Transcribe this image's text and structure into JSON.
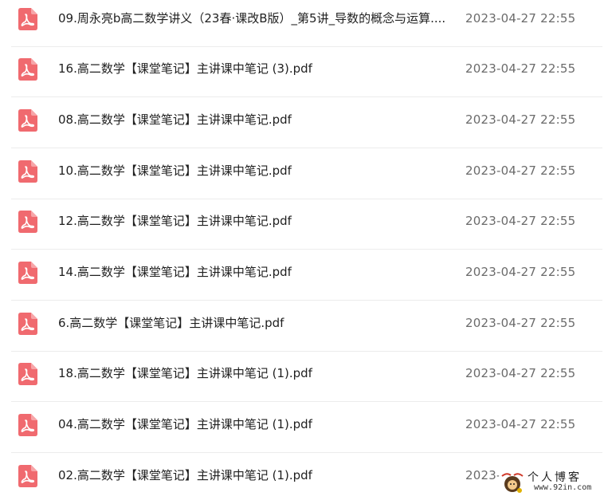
{
  "files": [
    {
      "name": "09.周永亮b高二数学讲义（23春·课改B版）_第5讲_导数的概念与运算....",
      "date": "2023-04-27 22:55",
      "icon": "pdf-icon"
    },
    {
      "name": "16.高二数学【课堂笔记】主讲课中笔记 (3).pdf",
      "date": "2023-04-27 22:55",
      "icon": "pdf-icon"
    },
    {
      "name": "08.高二数学【课堂笔记】主讲课中笔记.pdf",
      "date": "2023-04-27 22:55",
      "icon": "pdf-icon"
    },
    {
      "name": "10.高二数学【课堂笔记】主讲课中笔记.pdf",
      "date": "2023-04-27 22:55",
      "icon": "pdf-icon"
    },
    {
      "name": "12.高二数学【课堂笔记】主讲课中笔记.pdf",
      "date": "2023-04-27 22:55",
      "icon": "pdf-icon"
    },
    {
      "name": "14.高二数学【课堂笔记】主讲课中笔记.pdf",
      "date": "2023-04-27 22:55",
      "icon": "pdf-icon"
    },
    {
      "name": "6.高二数学【课堂笔记】主讲课中笔记.pdf",
      "date": "2023-04-27 22:55",
      "icon": "pdf-icon"
    },
    {
      "name": "18.高二数学【课堂笔记】主讲课中笔记 (1).pdf",
      "date": "2023-04-27 22:55",
      "icon": "pdf-icon"
    },
    {
      "name": "04.高二数学【课堂笔记】主讲课中笔记 (1).pdf",
      "date": "2023-04-27 22:55",
      "icon": "pdf-icon"
    },
    {
      "name": "02.高二数学【课堂笔记】主讲课中笔记 (1).pdf",
      "date": "2023-",
      "icon": "pdf-icon"
    }
  ],
  "watermark": {
    "title": "个人博客",
    "url": "www.92in.com",
    "icon": "blog-logo-icon"
  },
  "colors": {
    "pdf_icon": "#f06a6f",
    "border": "#ececec",
    "name_text": "#1f1f1f",
    "date_text": "#6b6b6b"
  }
}
